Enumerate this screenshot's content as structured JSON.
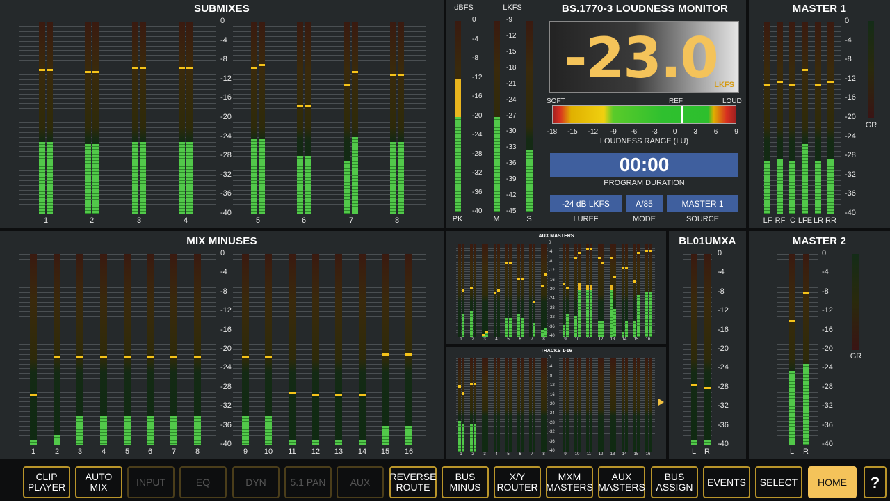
{
  "submixes": {
    "title": "SUBMIXES",
    "scale": [
      "0",
      "-4",
      "-8",
      "-12",
      "-16",
      "-20",
      "-24",
      "-28",
      "-32",
      "-36",
      "-40"
    ],
    "channels": [
      {
        "label": "1",
        "levels": [
          -25,
          -25
        ],
        "peaks": [
          -10,
          -10
        ]
      },
      {
        "label": "2",
        "levels": [
          -25.5,
          -25.5
        ],
        "peaks": [
          -10.5,
          -10.5
        ]
      },
      {
        "label": "3",
        "levels": [
          -25,
          -25
        ],
        "peaks": [
          -9.5,
          -9.5
        ]
      },
      {
        "label": "4",
        "levels": [
          -25,
          -25
        ],
        "peaks": [
          -9.5,
          -9.5
        ]
      },
      {
        "label": "5",
        "levels": [
          -24.5,
          -24.5
        ],
        "peaks": [
          -9.5,
          -9
        ]
      },
      {
        "label": "6",
        "levels": [
          -28,
          -28
        ],
        "peaks": [
          -17.5,
          -17.5
        ]
      },
      {
        "label": "7",
        "levels": [
          -29,
          -24
        ],
        "peaks": [
          -13,
          -10.5
        ]
      },
      {
        "label": "8",
        "levels": [
          -25,
          -25
        ],
        "peaks": [
          -11,
          -11
        ]
      }
    ]
  },
  "mix_minuses": {
    "title": "MIX MINUSES",
    "scale": [
      "0",
      "-4",
      "-8",
      "-12",
      "-16",
      "-20",
      "-24",
      "-28",
      "-32",
      "-36",
      "-40"
    ],
    "channels": [
      {
        "label": "1",
        "level": -39,
        "peak": -29.5
      },
      {
        "label": "2",
        "level": -38,
        "peak": -21.5
      },
      {
        "label": "3",
        "level": -34,
        "peak": -21.5
      },
      {
        "label": "4",
        "level": -34,
        "peak": -21.5
      },
      {
        "label": "5",
        "level": -34,
        "peak": -21.5
      },
      {
        "label": "6",
        "level": -34,
        "peak": -21.5
      },
      {
        "label": "7",
        "level": -34,
        "peak": -21.5
      },
      {
        "label": "8",
        "level": -34,
        "peak": -21.5
      },
      {
        "label": "9",
        "level": -34,
        "peak": -21.5
      },
      {
        "label": "10",
        "level": -34,
        "peak": -21.5
      },
      {
        "label": "11",
        "level": -39,
        "peak": -29
      },
      {
        "label": "12",
        "level": -39,
        "peak": -29.5
      },
      {
        "label": "13",
        "level": -39,
        "peak": -29.5
      },
      {
        "label": "14",
        "level": -39,
        "peak": -29.5
      },
      {
        "label": "15",
        "level": -36,
        "peak": -21
      },
      {
        "label": "16",
        "level": -36,
        "peak": -21
      }
    ]
  },
  "loudness": {
    "title": "BS.1770-3 LOUDNESS MONITOR",
    "value": "-23.0",
    "unit": "LKFS",
    "dbfs_label": "dBFS",
    "lkfs_label": "LKFS",
    "dbfs_scale": [
      "0",
      "-4",
      "-8",
      "-12",
      "-16",
      "-20",
      "-24",
      "-28",
      "-32",
      "-36",
      "-40"
    ],
    "lkfs_scale": [
      "-9",
      "-12",
      "-15",
      "-18",
      "-21",
      "-24",
      "-27",
      "-30",
      "-33",
      "-36",
      "-39",
      "-42",
      "-45"
    ],
    "pk_label": "PK",
    "m_label": "M",
    "s_label": "S",
    "pk_level": -12,
    "m_level": -20,
    "s_level": -27,
    "range_soft": "SOFT",
    "range_ref": "REF",
    "range_loud": "LOUD",
    "range_ticks": [
      "-18",
      "-15",
      "-12",
      "-9",
      "-6",
      "-3",
      "0",
      "3",
      "6",
      "9"
    ],
    "range_label": "LOUDNESS RANGE (LU)",
    "duration": "00:00",
    "duration_label": "PROGRAM DURATION",
    "luref_value": "-24 dB LKFS",
    "luref_label": "LUREF",
    "mode_value": "A/85",
    "mode_label": "MODE",
    "source_value": "MASTER 1",
    "source_label": "SOURCE"
  },
  "master1": {
    "title": "MASTER 1",
    "scale": [
      "0",
      "-4",
      "-8",
      "-12",
      "-16",
      "-20",
      "-24",
      "-28",
      "-32",
      "-36",
      "-40"
    ],
    "gr_label": "GR",
    "channels": [
      {
        "label": "LF",
        "level": -29,
        "peak": -13
      },
      {
        "label": "RF",
        "level": -28.5,
        "peak": -12.5
      },
      {
        "label": "C",
        "level": -29,
        "peak": -13
      },
      {
        "label": "LFE",
        "level": -25.5,
        "peak": -10
      },
      {
        "label": "LR",
        "level": -29,
        "peak": -13
      },
      {
        "label": "RR",
        "level": -28.5,
        "peak": -12.5
      }
    ]
  },
  "aux_masters": {
    "title": "AUX MASTERS",
    "scale": [
      "0",
      "-4",
      "-8",
      "-12",
      "-16",
      "-20",
      "-24",
      "-28",
      "-32",
      "-36",
      "-40"
    ],
    "labels": [
      "1",
      "2",
      "3",
      "4",
      "5",
      "6",
      "7",
      "8",
      "9",
      "10",
      "11",
      "12",
      "13",
      "14",
      "15",
      "16"
    ]
  },
  "tracks": {
    "title": "TRACKS 1-16",
    "scale": [
      "0",
      "-4",
      "-8",
      "-12",
      "-16",
      "-20",
      "-24",
      "-28",
      "-32",
      "-36",
      "-40"
    ],
    "labels": [
      "1",
      "2",
      "3",
      "4",
      "5",
      "6",
      "7",
      "8",
      "9",
      "10",
      "11",
      "12",
      "13",
      "14",
      "15",
      "16"
    ]
  },
  "bl01": {
    "title": "BL01UMXA",
    "scale": [
      "0",
      "-4",
      "-8",
      "-12",
      "-16",
      "-20",
      "-24",
      "-28",
      "-32",
      "-36",
      "-40"
    ],
    "channels": [
      {
        "label": "L",
        "level": -39,
        "peak": -27.5
      },
      {
        "label": "R",
        "level": -39,
        "peak": -28
      }
    ]
  },
  "master2": {
    "title": "MASTER 2",
    "scale": [
      "0",
      "-4",
      "-8",
      "-12",
      "-16",
      "-20",
      "-24",
      "-28",
      "-32",
      "-36",
      "-40"
    ],
    "gr_label": "GR",
    "channels": [
      {
        "label": "L",
        "level": -24.5,
        "peak": -14
      },
      {
        "label": "R",
        "level": -23,
        "peak": -8
      }
    ]
  },
  "toolbar": [
    {
      "label": "CLIP\nPLAYER",
      "state": "normal"
    },
    {
      "label": "AUTO\nMIX",
      "state": "normal"
    },
    {
      "label": "INPUT",
      "state": "dim"
    },
    {
      "label": "EQ",
      "state": "dim"
    },
    {
      "label": "DYN",
      "state": "dim"
    },
    {
      "label": "5.1 PAN",
      "state": "dim"
    },
    {
      "label": "AUX",
      "state": "dim"
    },
    {
      "label": "REVERSE\nROUTE",
      "state": "normal"
    },
    {
      "label": "BUS\nMINUS",
      "state": "normal"
    },
    {
      "label": "X/Y\nROUTER",
      "state": "normal"
    },
    {
      "label": "MXM\nMASTERS",
      "state": "normal"
    },
    {
      "label": "AUX\nMASTERS",
      "state": "normal"
    },
    {
      "label": "BUS\nASSIGN",
      "state": "normal"
    },
    {
      "label": "EVENTS",
      "state": "normal"
    },
    {
      "label": "SELECT",
      "state": "normal"
    },
    {
      "label": "HOME",
      "state": "active"
    },
    {
      "label": "?",
      "state": "normal"
    }
  ]
}
